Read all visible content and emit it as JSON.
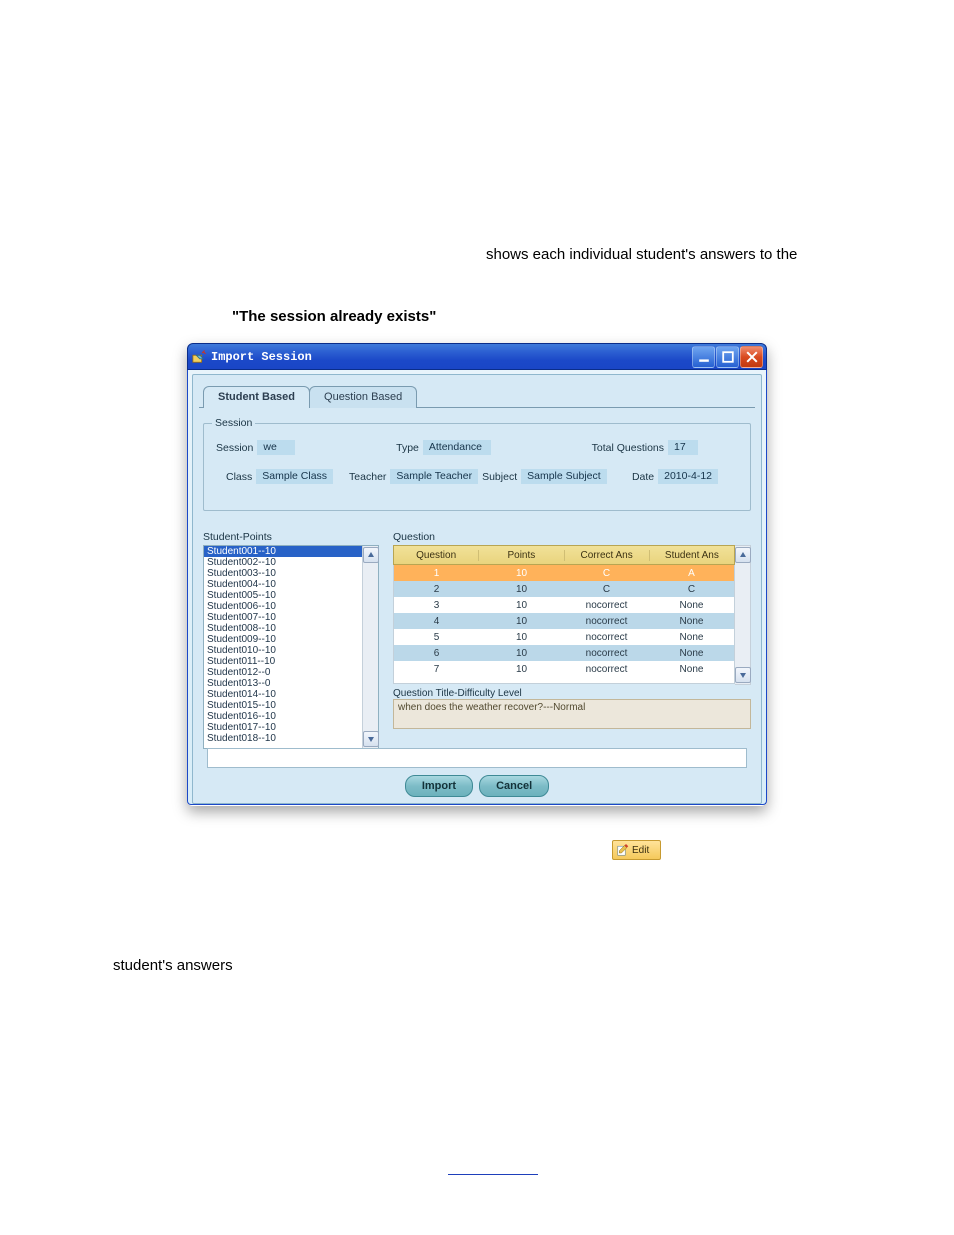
{
  "page": {
    "text_top": "shows each individual student's answers to the",
    "text_bold": "\"The session already exists\"",
    "text_bottom": "student's answers"
  },
  "window": {
    "title": "Import Session",
    "tabs": [
      {
        "label": "Student Based",
        "active": true
      },
      {
        "label": "Question Based",
        "active": false
      }
    ],
    "session": {
      "legend": "Session",
      "row1": {
        "session_label": "Session",
        "session_value": "we",
        "type_label": "Type",
        "type_value": "Attendance",
        "total_q_label": "Total Questions",
        "total_q_value": "17"
      },
      "row2": {
        "class_label": "Class",
        "class_value": "Sample Class",
        "teacher_label": "Teacher",
        "teacher_value": "Sample Teacher",
        "subject_label": "Subject",
        "subject_value": "Sample Subject",
        "date_label": "Date",
        "date_value": "2010-4-12"
      }
    },
    "students": {
      "label": "Student-Points",
      "items": [
        "Student001--10",
        "Student002--10",
        "Student003--10",
        "Student004--10",
        "Student005--10",
        "Student006--10",
        "Student007--10",
        "Student008--10",
        "Student009--10",
        "Student010--10",
        "Student011--10",
        "Student012--0",
        "Student013--0",
        "Student014--10",
        "Student015--10",
        "Student016--10",
        "Student017--10",
        "Student018--10"
      ],
      "selected_index": 0
    },
    "question": {
      "label": "Question",
      "headers": [
        "Question",
        "Points",
        "Correct Ans",
        "Student Ans"
      ],
      "rows": [
        {
          "q": "1",
          "pts": "10",
          "ca": "C",
          "sa": "A",
          "selected": true
        },
        {
          "q": "2",
          "pts": "10",
          "ca": "C",
          "sa": "C",
          "hl": true
        },
        {
          "q": "3",
          "pts": "10",
          "ca": "nocorrect",
          "sa": "None"
        },
        {
          "q": "4",
          "pts": "10",
          "ca": "nocorrect",
          "sa": "None",
          "hl": true
        },
        {
          "q": "5",
          "pts": "10",
          "ca": "nocorrect",
          "sa": "None"
        },
        {
          "q": "6",
          "pts": "10",
          "ca": "nocorrect",
          "sa": "None",
          "hl": true
        },
        {
          "q": "7",
          "pts": "10",
          "ca": "nocorrect",
          "sa": "None"
        }
      ],
      "qtitle_label": "Question Title-Difficulty Level",
      "qtitle_value": "when does the weather recover?---Normal"
    },
    "buttons": {
      "import": "Import",
      "cancel": "Cancel"
    }
  },
  "edit_badge": "Edit"
}
